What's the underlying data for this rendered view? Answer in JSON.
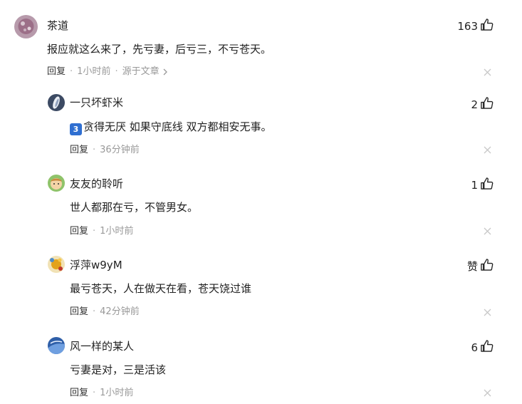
{
  "comments": [
    {
      "name": "茶道",
      "text": "报应就这么来了，先亏妻，后亏三，不亏苍天。",
      "likes": "163",
      "reply_label": "回复",
      "time": "1小时前",
      "source": "源于文章"
    }
  ],
  "replies": [
    {
      "name": "一只坏虾米",
      "badge": "3",
      "text": "贪得无厌 如果守底线 双方都相安无事。",
      "likes": "2",
      "reply_label": "回复",
      "time": "36分钟前"
    },
    {
      "name": "友友的聆听",
      "text": "世人都那在亏，不管男女。",
      "likes": "1",
      "reply_label": "回复",
      "time": "1小时前"
    },
    {
      "name": "浮萍w9yM",
      "text": "最亏苍天，人在做天在看，苍天饶过谁",
      "likes": "赞",
      "reply_label": "回复",
      "time": "42分钟前"
    },
    {
      "name": "风一样的某人",
      "text": "亏妻是对，三是活该",
      "likes": "6",
      "reply_label": "回复",
      "time": "1小时前"
    }
  ],
  "colors": {
    "text": "#222222",
    "meta": "#999999",
    "badge": "#2f6fd1"
  }
}
